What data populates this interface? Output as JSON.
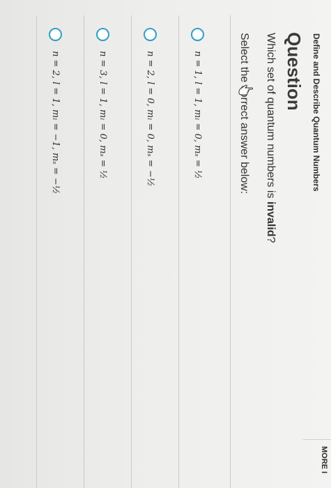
{
  "topic": "Define and Describe Quantum Numbers",
  "question": {
    "heading": "Question",
    "text_before": "Which set of quantum numbers is ",
    "text_emphasis": "invalid",
    "text_after": "?"
  },
  "instruction": "Select the correct answer below:",
  "choices": [
    {
      "label": "n = 1, l = 1, mₗ = 0, mₛ = ½"
    },
    {
      "label": "n = 2, l = 0, mₗ = 0, mₛ = −½"
    },
    {
      "label": "n = 3, l = 1, mₗ = 0, mₛ = ½"
    },
    {
      "label": "n = 2, l = 1, mₗ = −1, mₛ = −½"
    }
  ],
  "footer": {
    "more_label": "MORE I"
  },
  "colors": {
    "radio_border": "#2e9fc4",
    "background": "#ecedeb"
  },
  "icons": {
    "cursor": "hand-pointer-icon"
  }
}
